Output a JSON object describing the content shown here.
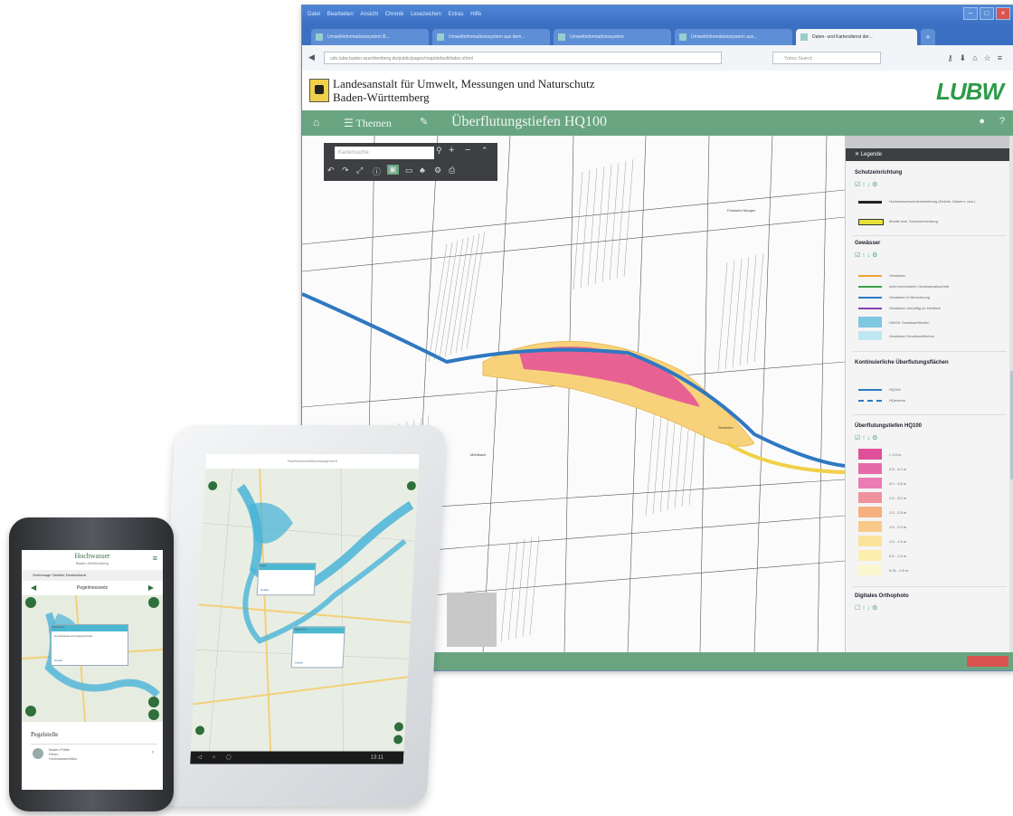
{
  "desktop": {
    "menubar": [
      "Datei",
      "Bearbeiten",
      "Ansicht",
      "Chronik",
      "Lesezeichen",
      "Extras",
      "Hilfe"
    ],
    "tabs": [
      {
        "label": "Umweltinformationssystem B...",
        "active": false
      },
      {
        "label": "Umweltinformationssystem aus dem...",
        "active": false
      },
      {
        "label": "Umweltinformationssystem",
        "active": false
      },
      {
        "label": "Umweltinformationssystem aus...",
        "active": false
      },
      {
        "label": "Daten- und Kartendienst der...",
        "active": true
      }
    ],
    "url": "udo.lubw.baden-wuerttemberg.de/public/pages/map/default/index.xhtml",
    "search_placeholder": "Yahoo Search",
    "org_line1": "Landesanstalt für Umwelt, Messungen und Naturschutz",
    "org_line2": "Baden-Württemberg",
    "logo": "LUBW",
    "themen": "Themen",
    "map_title": "Überflutungstiefen HQ100",
    "map_search_placeholder": "Kartensuche",
    "legend": {
      "title": "Legende",
      "sections": [
        {
          "name": "Schutzeinrichtung",
          "items": [
            "Hochwasserschutzeinrichtung (Deiche, Mauern, usw.)",
            "Mobile bzw. Schutzeinrichtung"
          ]
        },
        {
          "name": "Gewässer",
          "items": [
            "Gewässer",
            "nicht berechneter Gewässerabschnitt",
            "Gewässer in Berechnung",
            "Gewässer zukünftig zu ermitteln",
            "HWGK Gewässerflächen",
            "Gewässer Gewässerflächen"
          ]
        },
        {
          "name": "Kontinuierliche Überflutungsflächen",
          "items": [
            "HQ100",
            "HQextrem"
          ]
        },
        {
          "name": "Überflutungstiefen HQ100",
          "items": [
            "> 4.0 m",
            "3.5 - 4.0 m",
            "3.0 - 3.5 m",
            "2.5 - 3.0 m",
            "2.0 - 2.5 m",
            "1.5 - 2.0 m",
            "1.0 - 1.5 m",
            "0.5 - 1.0 m",
            "0.01 - 0.5 m"
          ]
        },
        {
          "name": "Digitales Orthophoto",
          "items": []
        }
      ],
      "depth_colors": [
        "#e0509a",
        "#e56aa8",
        "#ea7db2",
        "#f0929e",
        "#f6b07e",
        "#f9c98a",
        "#fbe29c",
        "#fcefaf",
        "#fdf7cf"
      ]
    },
    "map_labels": [
      "Mühlbach",
      "Fünfzehn Morgen",
      "Seeäcker"
    ]
  },
  "tablet": {
    "header": "Hochwasserrisikomanagement",
    "popup1": "Pegel",
    "popup2": "Pegelstelle",
    "popup_link": "Details",
    "clock": "13:11"
  },
  "phone": {
    "title": "Hochwasser",
    "subtitle": "Baden-Württemberg",
    "bar": "Vorhersage Gebiete Deutschland",
    "nav_label": "Pegelmessnetz",
    "popup_title": "Pegelstelle",
    "popup_text": "Hochwasservorhersagezentrale",
    "popup_link": "Details",
    "pegel_heading": "Pegelstelle",
    "row_title": "Baden-Plätte",
    "row_sub1": "Rhein",
    "row_sub2": "Hochwasserrisiko"
  }
}
